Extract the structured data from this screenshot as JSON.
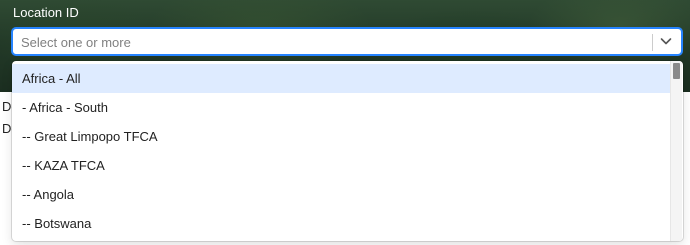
{
  "field": {
    "label": "Location ID",
    "placeholder": "Select one or more"
  },
  "background_text": [
    "Do",
    "Do"
  ],
  "dropdown": {
    "options": [
      {
        "label": "Africa - All",
        "focused": true
      },
      {
        "label": "- Africa - South",
        "focused": false
      },
      {
        "label": "-- Great Limpopo TFCA",
        "focused": false
      },
      {
        "label": "-- KAZA TFCA",
        "focused": false
      },
      {
        "label": "-- Angola",
        "focused": false
      },
      {
        "label": "-- Botswana",
        "focused": false
      }
    ]
  },
  "icons": {
    "dropdown_indicator": "chevron-down-icon"
  },
  "colors": {
    "focus_border": "#2684ff",
    "focused_option_bg": "#deebff",
    "placeholder_text": "#808080"
  }
}
